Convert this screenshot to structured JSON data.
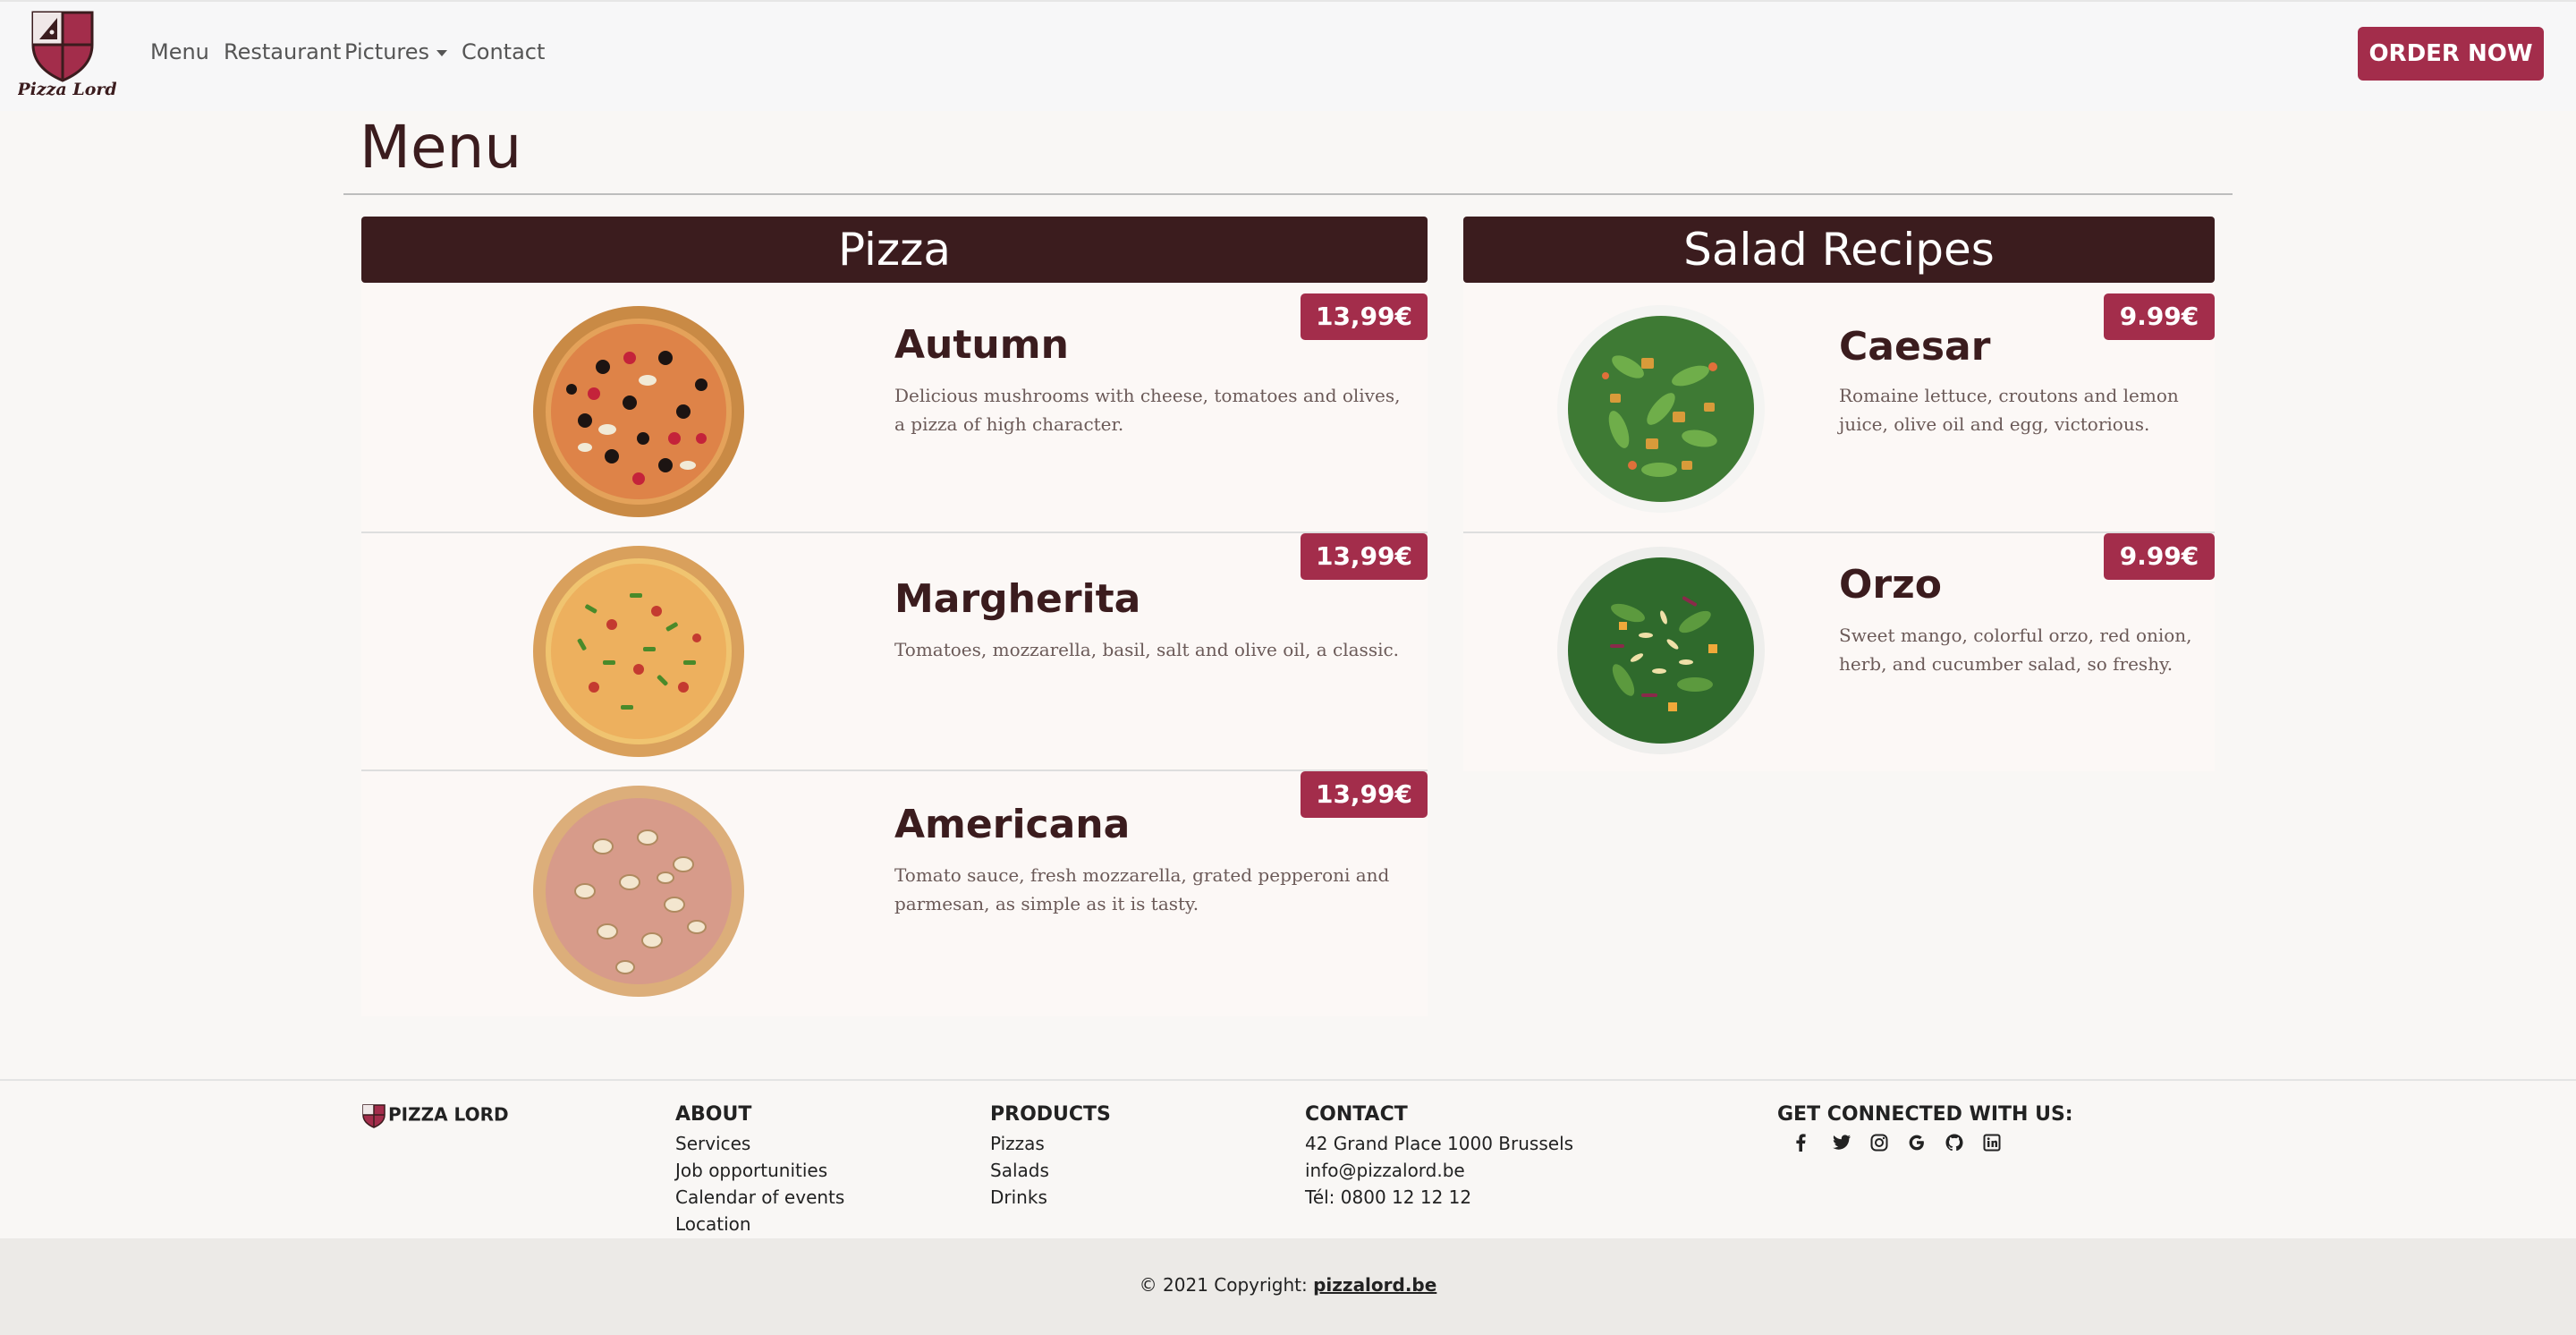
{
  "brand": {
    "name": "Pizza Lord",
    "footer_name": "PIZZA LORD"
  },
  "nav": {
    "items": [
      {
        "label": "Menu"
      },
      {
        "label": "Restaurant"
      },
      {
        "label": "Pictures"
      },
      {
        "label": "Contact"
      }
    ],
    "order_label": "ORDER NOW"
  },
  "page": {
    "title": "Menu"
  },
  "pizza": {
    "heading": "Pizza",
    "items": [
      {
        "name": "Autumn",
        "price": "13,99€",
        "description": "Delicious mushrooms with cheese, tomatoes and olives, a pizza of high character."
      },
      {
        "name": "Margherita",
        "price": "13,99€",
        "description": "Tomatoes, mozzarella, basil, salt and olive oil, a classic."
      },
      {
        "name": "Americana",
        "price": "13,99€",
        "description": "Tomato sauce, fresh mozzarella, grated pepperoni and parmesan, as simple as it is tasty."
      }
    ]
  },
  "salad": {
    "heading": "Salad Recipes",
    "items": [
      {
        "name": "Caesar",
        "price": "9.99€",
        "description": "Romaine lettuce, croutons and lemon juice, olive oil and egg, victorious."
      },
      {
        "name": "Orzo",
        "price": "9.99€",
        "description": "Sweet mango, colorful orzo, red onion, herb, and cucumber salad, so freshy."
      }
    ]
  },
  "footer": {
    "about": {
      "heading": "ABOUT",
      "links": [
        "Services",
        "Job opportunities",
        "Calendar of events",
        "Location"
      ]
    },
    "products": {
      "heading": "PRODUCTS",
      "links": [
        "Pizzas",
        "Salads",
        "Drinks"
      ]
    },
    "contact": {
      "heading": "CONTACT",
      "lines": [
        "42 Grand Place 1000 Brussels",
        "info@pizzalord.be",
        "Tél: 0800 12 12 12"
      ]
    },
    "social": {
      "heading": "GET CONNECTED WITH US:",
      "icons": [
        "facebook-icon",
        "twitter-icon",
        "instagram-icon",
        "google-icon",
        "github-icon",
        "linkedin-icon"
      ]
    },
    "copyright_text": "© 2021 Copyright:",
    "copyright_link": "pizzalord.be"
  },
  "colors": {
    "accent": "#a32d4b",
    "dark": "#3b1c1e",
    "background": "#f9f7f5"
  }
}
